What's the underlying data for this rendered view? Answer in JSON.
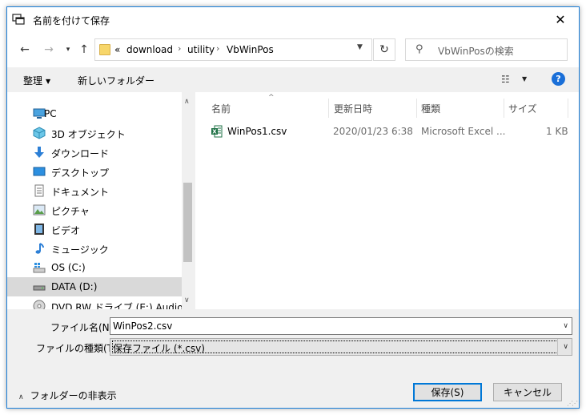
{
  "window": {
    "title": "名前を付けて保存",
    "close_glyph": "✕"
  },
  "address_bar": {
    "overflow": "«",
    "breadcrumbs": [
      "download",
      "utility",
      "VbWinPos"
    ],
    "separator": "›"
  },
  "search": {
    "placeholder": "VbWinPosの検索"
  },
  "toolbar": {
    "organize_label": "整理",
    "new_folder_label": "新しいフォルダー",
    "help_label": "?"
  },
  "nav_pane": {
    "items": [
      {
        "label": "PC",
        "icon": "pc-icon"
      },
      {
        "label": "3D オブジェクト",
        "icon": "3d-objects-icon"
      },
      {
        "label": "ダウンロード",
        "icon": "download-icon"
      },
      {
        "label": "デスクトップ",
        "icon": "desktop-icon"
      },
      {
        "label": "ドキュメント",
        "icon": "documents-icon"
      },
      {
        "label": "ピクチャ",
        "icon": "pictures-icon"
      },
      {
        "label": "ビデオ",
        "icon": "video-icon"
      },
      {
        "label": "ミュージック",
        "icon": "music-icon"
      },
      {
        "label": "OS (C:)",
        "icon": "drive-c-icon"
      },
      {
        "label": "DATA (D:)",
        "icon": "drive-d-icon"
      },
      {
        "label": "DVD RW ドライブ (E:) Audio CD",
        "icon": "dvd-drive-icon"
      }
    ],
    "selected": "DATA (D:)"
  },
  "file_list": {
    "columns": {
      "name": "名前",
      "date": "更新日時",
      "type": "種類",
      "size": "サイズ"
    },
    "rows": [
      {
        "name": "WinPos1.csv",
        "date": "2020/01/23 6:38",
        "type": "Microsoft Excel ...",
        "size": "1 KB"
      }
    ]
  },
  "form": {
    "filename_label": "ファイル名(N):",
    "filename_value": "WinPos2.csv",
    "filetype_label": "ファイルの種類(T):",
    "filetype_value": "保存ファイル (*.csv)"
  },
  "buttons": {
    "hide_folders_label": "フォルダーの非表示",
    "save_label": "保存(S)",
    "cancel_label": "キャンセル"
  },
  "colors": {
    "window_border": "#1a7ed8",
    "help_icon": "#1a6fd8",
    "primary_button_border": "#0078d7",
    "excel_green": "#1d7044"
  }
}
